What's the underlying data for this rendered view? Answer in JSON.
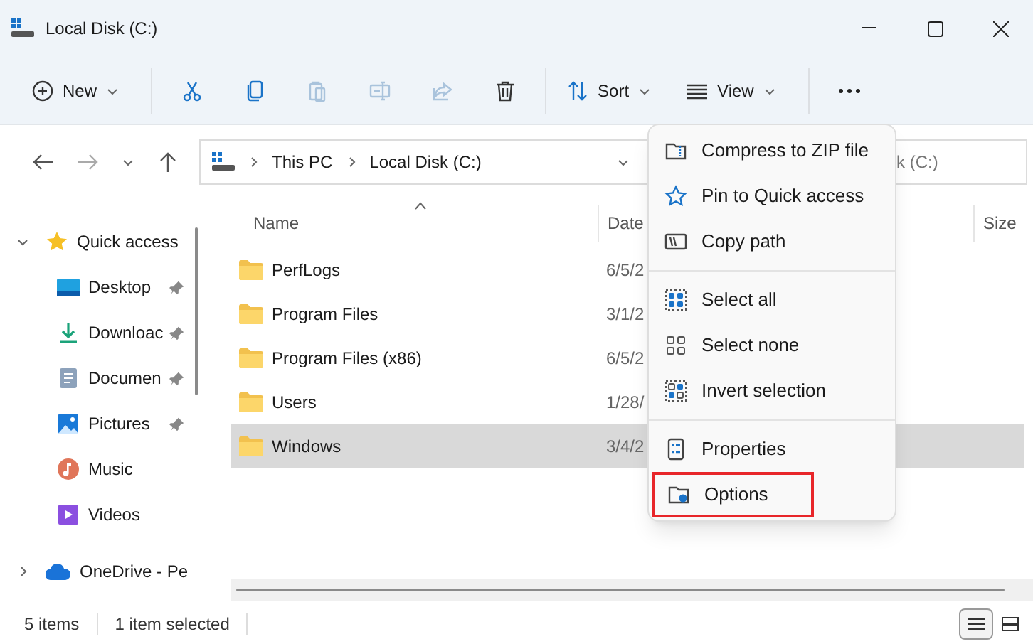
{
  "window": {
    "title": "Local Disk (C:)"
  },
  "toolbar": [
    {
      "kind": "new",
      "label": "New",
      "disabled": false
    },
    {
      "kind": "cut",
      "disabled": false
    },
    {
      "kind": "copy",
      "disabled": false
    },
    {
      "kind": "paste",
      "disabled": true
    },
    {
      "kind": "rename",
      "disabled": true
    },
    {
      "kind": "share",
      "disabled": true
    },
    {
      "kind": "delete",
      "disabled": false
    },
    {
      "kind": "sort",
      "label": "Sort",
      "disabled": false
    },
    {
      "kind": "view",
      "label": "View",
      "disabled": false
    },
    {
      "kind": "more",
      "disabled": false
    }
  ],
  "address": {
    "crumbs": [
      "This PC",
      "Local Disk (C:)"
    ]
  },
  "search": {
    "placeholder": "k (C:)"
  },
  "sidebar": {
    "items": [
      {
        "kind": "quick",
        "label": "Quick access",
        "expanded": true,
        "pinned": false
      },
      {
        "kind": "desktop",
        "label": "Desktop",
        "pinned": true
      },
      {
        "kind": "downloads",
        "label": "Downloac",
        "pinned": true
      },
      {
        "kind": "documents",
        "label": "Documen",
        "pinned": true
      },
      {
        "kind": "pictures",
        "label": "Pictures",
        "pinned": true
      },
      {
        "kind": "music",
        "label": "Music",
        "pinned": false
      },
      {
        "kind": "videos",
        "label": "Videos",
        "pinned": false
      },
      {
        "kind": "onedrive",
        "label": "OneDrive - Pe",
        "expanded": false,
        "pinned": false
      }
    ]
  },
  "table": {
    "columns": [
      "Name",
      "Date",
      "Size"
    ],
    "rows": [
      {
        "name": "PerfLogs",
        "date": "6/5/2",
        "selected": false
      },
      {
        "name": "Program Files",
        "date": "3/1/2",
        "selected": false
      },
      {
        "name": "Program Files (x86)",
        "date": "6/5/2",
        "selected": false
      },
      {
        "name": "Users",
        "date": "1/28/",
        "selected": false
      },
      {
        "name": "Windows",
        "date": "3/4/2",
        "selected": true
      }
    ]
  },
  "context_menu": {
    "groups": [
      [
        {
          "kind": "zip",
          "label": "Compress to ZIP file",
          "highlighted": false
        },
        {
          "kind": "pin",
          "label": "Pin to Quick access",
          "highlighted": false
        },
        {
          "kind": "path",
          "label": "Copy path",
          "highlighted": false
        }
      ],
      [
        {
          "kind": "all",
          "label": "Select all",
          "highlighted": false
        },
        {
          "kind": "none",
          "label": "Select none",
          "highlighted": false
        },
        {
          "kind": "invert",
          "label": "Invert selection",
          "highlighted": false
        }
      ],
      [
        {
          "kind": "props",
          "label": "Properties",
          "highlighted": false
        },
        {
          "kind": "options",
          "label": "Options",
          "highlighted": true
        }
      ]
    ]
  },
  "status_bar": {
    "count": "5 items",
    "selection": "1 item selected",
    "views": [
      {
        "kind": "details",
        "selected": true
      },
      {
        "kind": "tiles",
        "selected": false
      }
    ]
  }
}
